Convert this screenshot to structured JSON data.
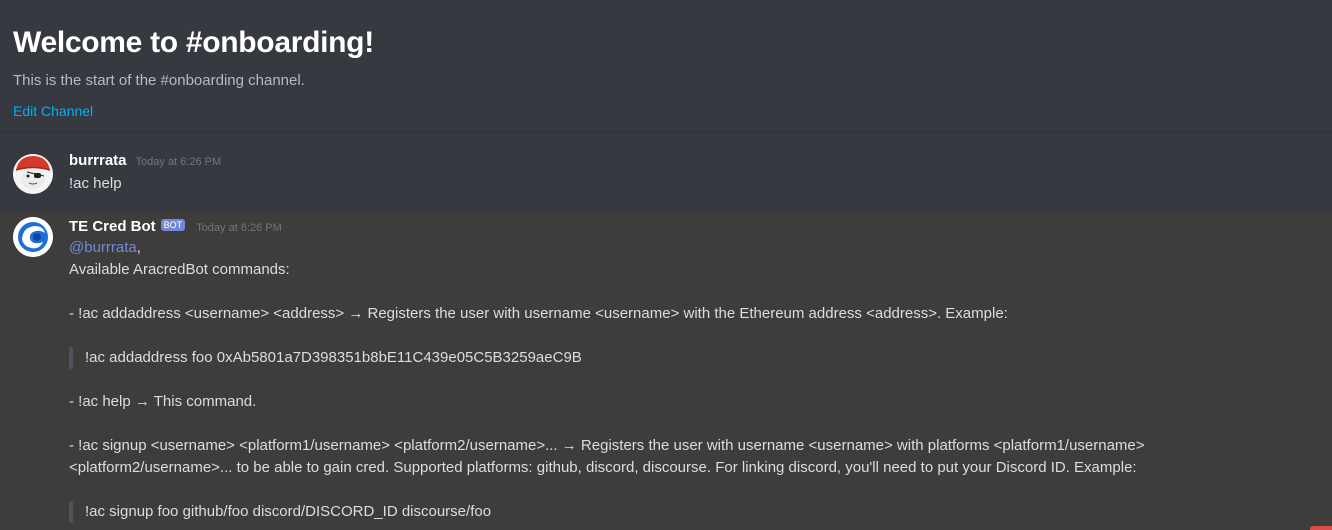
{
  "welcome": {
    "title": "Welcome to #onboarding!",
    "subtitle": "This is the start of the #onboarding channel.",
    "edit_label": "Edit Channel"
  },
  "messages": [
    {
      "username": "burrrata",
      "timestamp": "Today at 6:26 PM",
      "text": "!ac help"
    },
    {
      "username": "TE Cred Bot",
      "badge": "BOT",
      "timestamp": "Today at 6:26 PM",
      "mention": "@burrrata",
      "mention_suffix": ",",
      "lines": {
        "l1": "Available AracredBot commands:",
        "l2": "- !ac addaddress <username> <address> → Registers the user with username <username> with the Ethereum address <address>. Example:",
        "q1": "!ac addaddress foo 0xAb5801a7D398351b8bE11C439e05C5B3259aeC9B",
        "l3": "- !ac help → This command.",
        "l4": "- !ac signup <username> <platform1/username> <platform2/username>... → Registers the user with username <username> with platforms <platform1/username>",
        "l5": "<platform2/username>... to be able to gain cred. Supported platforms: github, discord, discourse. For linking discord, you'll need to put your Discord ID. Example:",
        "q2": "!ac signup foo github/foo discord/DISCORD_ID discourse/foo"
      }
    }
  ],
  "colors": {
    "background": "#36393f",
    "bot_message_background": "#3e3d3c",
    "link": "#00b0f4",
    "mention": "#7289da",
    "badge": "#7289da"
  },
  "icons": {
    "burrrata_avatar": "pirate-avatar-icon",
    "bot_avatar": "wave-avatar-icon"
  }
}
